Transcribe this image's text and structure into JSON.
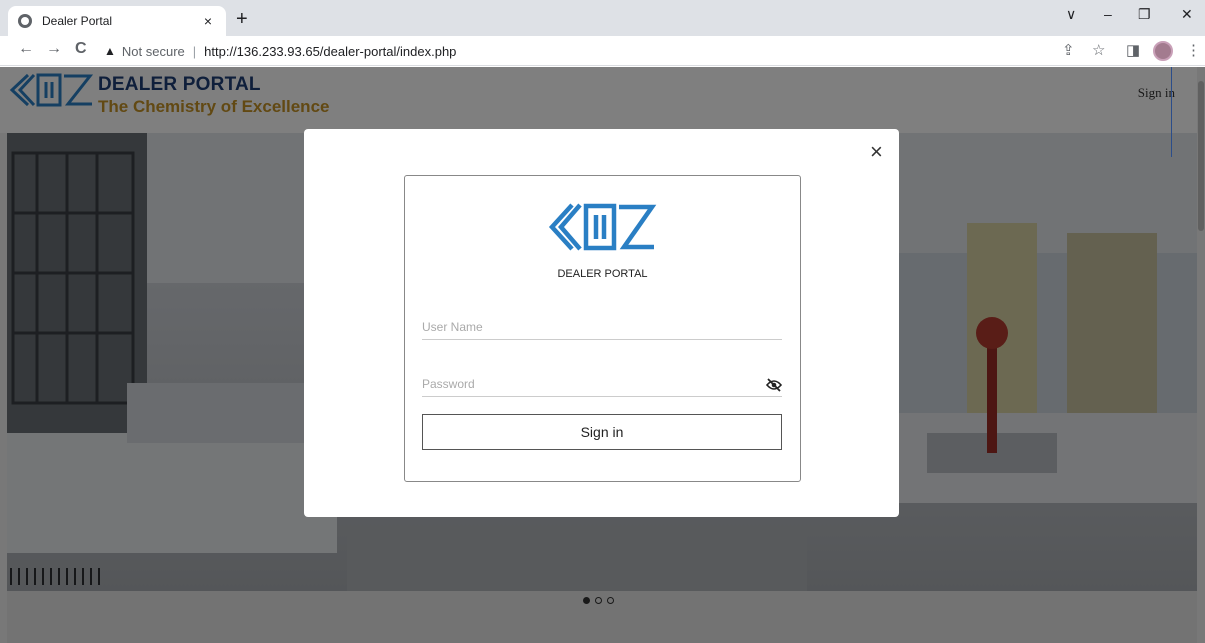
{
  "browser": {
    "tab_title": "Dealer Portal",
    "tab_close": "×",
    "new_tab": "+",
    "win_down": "∨",
    "win_min": "–",
    "win_restore": "❐",
    "win_close": "✕",
    "back": "←",
    "forward": "→",
    "reload": "C",
    "security_label": "Not secure",
    "url": "http://136.233.93.65/dealer-portal/index.php"
  },
  "header": {
    "title": "DEALER PORTAL",
    "tagline": "The Chemistry of Excellence",
    "signin": "Sign in"
  },
  "modal": {
    "close": "×",
    "portal_title": "DEALER PORTAL",
    "username_placeholder": "User Name",
    "password_placeholder": "Password",
    "signin_button": "Sign in"
  },
  "carousel": {
    "slides": 3,
    "active": 0
  },
  "colors": {
    "brand_blue": "#1f4f8a",
    "brand_gold": "#c59226",
    "logo_blue": "#2a7fc4"
  }
}
